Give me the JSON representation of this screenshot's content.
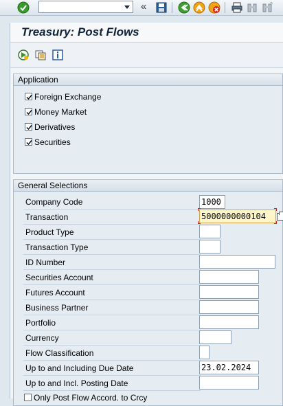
{
  "toolbar": {
    "command_field_value": "",
    "icons": [
      "enter-icon",
      "save-icon",
      "back-icon",
      "exit-icon",
      "cancel-icon",
      "print-icon",
      "find-icon",
      "find-next-icon"
    ]
  },
  "screen": {
    "title": "Treasury: Post Flows",
    "app_toolbar_icons": [
      "execute-icon",
      "get-variant-icon",
      "info-icon"
    ]
  },
  "application": {
    "header": "Application",
    "options": [
      {
        "label": "Foreign Exchange",
        "checked": true
      },
      {
        "label": "Money Market",
        "checked": true
      },
      {
        "label": "Derivatives",
        "checked": true
      },
      {
        "label": "Securities",
        "checked": true
      }
    ]
  },
  "general": {
    "header": "General Selections",
    "fields": {
      "company_code": {
        "label": "Company Code",
        "value": "1000"
      },
      "transaction": {
        "label": "Transaction",
        "value": "5000000000104"
      },
      "product_type": {
        "label": "Product Type",
        "value": ""
      },
      "transaction_type": {
        "label": "Transaction Type",
        "value": ""
      },
      "id_number": {
        "label": "ID Number",
        "value": ""
      },
      "securities_account": {
        "label": "Securities Account",
        "value": ""
      },
      "futures_account": {
        "label": "Futures Account",
        "value": ""
      },
      "business_partner": {
        "label": "Business Partner",
        "value": ""
      },
      "portfolio": {
        "label": "Portfolio",
        "value": ""
      },
      "currency": {
        "label": "Currency",
        "value": ""
      },
      "flow_classification": {
        "label": "Flow Classification",
        "value": ""
      },
      "due_date": {
        "label": "Up to and Including Due Date",
        "value": "23.02.2024"
      },
      "posting_date": {
        "label": "Up to and Incl. Posting Date",
        "value": ""
      }
    },
    "only_post_flow": {
      "label": "Only Post Flow Accord. to Crcy",
      "checked": false
    }
  },
  "colors": {
    "accent_active_field": "#fff6c8",
    "required_marker": "#d21f1f",
    "title_text": "#10243a"
  }
}
